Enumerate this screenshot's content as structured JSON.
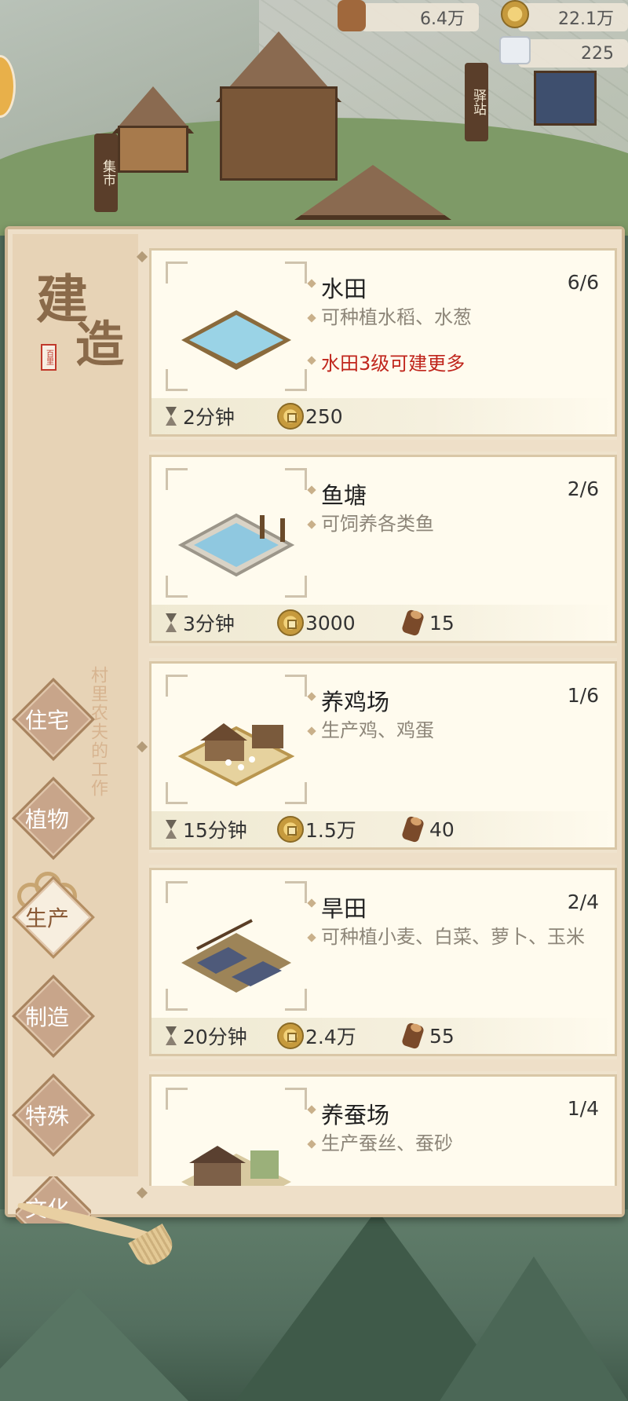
{
  "resources": {
    "wood": "6.4万",
    "coins": "22.1万",
    "stone": "225"
  },
  "scene": {
    "sign_market": "集市",
    "sign_station": "驿站"
  },
  "sidebar": {
    "title_char_1": "建",
    "title_char_2": "造",
    "seal_text": "百里",
    "caption": "村里农夫的工作",
    "tabs": [
      {
        "label": "住宅"
      },
      {
        "label": "植物"
      },
      {
        "label": "生产"
      },
      {
        "label": "制造"
      },
      {
        "label": "特殊"
      },
      {
        "label": "文化"
      }
    ],
    "active_tab": "生产"
  },
  "buildings": [
    {
      "name": "水田",
      "count": "6/6",
      "desc": "可种植水稻、水葱",
      "warning": "水田3级可建更多",
      "time": "2分钟",
      "coins": "250",
      "wood": ""
    },
    {
      "name": "鱼塘",
      "count": "2/6",
      "desc": "可饲养各类鱼",
      "warning": "",
      "time": "3分钟",
      "coins": "3000",
      "wood": "15"
    },
    {
      "name": "养鸡场",
      "count": "1/6",
      "desc": "生产鸡、鸡蛋",
      "warning": "",
      "time": "15分钟",
      "coins": "1.5万",
      "wood": "40"
    },
    {
      "name": "旱田",
      "count": "2/4",
      "desc": "可种植小麦、白菜、萝卜、玉米",
      "warning": "",
      "time": "20分钟",
      "coins": "2.4万",
      "wood": "55"
    },
    {
      "name": "养蚕场",
      "count": "1/4",
      "desc": "生产蚕丝、蚕砂",
      "warning": "",
      "time": "",
      "coins": "",
      "wood": ""
    }
  ],
  "colors": {
    "accent_warning": "#c0251c",
    "panel_bg": "#eedfc8",
    "card_bg": "#fffbee"
  }
}
